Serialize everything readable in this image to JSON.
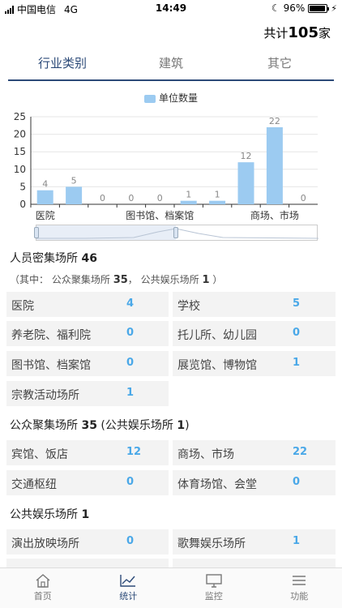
{
  "status_bar": {
    "carrier": "中国电信",
    "network": "4G",
    "time": "14:49",
    "battery": "96%"
  },
  "header": {
    "total_prefix": "共计",
    "total_count": "105",
    "total_suffix": "家"
  },
  "tabs": [
    {
      "label": "行业类别",
      "active": true
    },
    {
      "label": "建筑",
      "active": false
    },
    {
      "label": "其它",
      "active": false
    }
  ],
  "chart_data": {
    "type": "bar",
    "legend": "单位数量",
    "categories": [
      "医院",
      "学校",
      "养老院、福利院",
      "托儿所、幼儿园",
      "图书馆、档案馆",
      "展览馆、博物馆",
      "宗教活动场所",
      "宾馆、饭店",
      "商场、市场",
      "交通枢纽"
    ],
    "shown_tick_labels": [
      "医院",
      "图书馆、档案馆",
      "商场、市场"
    ],
    "values": [
      4,
      5,
      0,
      0,
      0,
      1,
      1,
      12,
      22,
      0
    ],
    "yticks": [
      "0",
      "5",
      "10",
      "15",
      "20",
      "25"
    ],
    "ylim": [
      0,
      25
    ],
    "color": "#9ccbf1"
  },
  "crowded": {
    "title": "人员密集场所",
    "count": "46",
    "note_open": "（其中：",
    "note_public_label": "公众聚集场所",
    "note_public_count": "35",
    "note_sep": "，",
    "note_ent_label": "公共娱乐场所",
    "note_ent_count": "1",
    "note_close": "）",
    "items": [
      {
        "label": "医院",
        "value": "4"
      },
      {
        "label": "学校",
        "value": "5"
      },
      {
        "label": "养老院、福利院",
        "value": "0"
      },
      {
        "label": "托儿所、幼儿园",
        "value": "0"
      },
      {
        "label": "图书馆、档案馆",
        "value": "0"
      },
      {
        "label": "展览馆、博物馆",
        "value": "1"
      },
      {
        "label": "宗教活动场所",
        "value": "1"
      }
    ]
  },
  "public_gathering": {
    "title": "公众聚集场所",
    "count": "35",
    "note_open": " (公共娱乐场所",
    "note_count": "1",
    "note_close": ")",
    "items": [
      {
        "label": "宾馆、饭店",
        "value": "12"
      },
      {
        "label": "商场、市场",
        "value": "22"
      },
      {
        "label": "交通枢纽",
        "value": "0"
      },
      {
        "label": "体育场馆、会堂",
        "value": "0"
      }
    ]
  },
  "entertainment": {
    "title": "公共娱乐场所",
    "count": "1",
    "items": [
      {
        "label": "演出放映场所",
        "value": "0"
      },
      {
        "label": "歌舞娱乐场所",
        "value": "1"
      }
    ]
  },
  "bottom_nav": [
    {
      "label": "首页",
      "icon": "home-icon",
      "active": false
    },
    {
      "label": "统计",
      "icon": "chart-icon",
      "active": true
    },
    {
      "label": "监控",
      "icon": "monitor-icon",
      "active": false
    },
    {
      "label": "功能",
      "icon": "menu-icon",
      "active": false
    }
  ]
}
